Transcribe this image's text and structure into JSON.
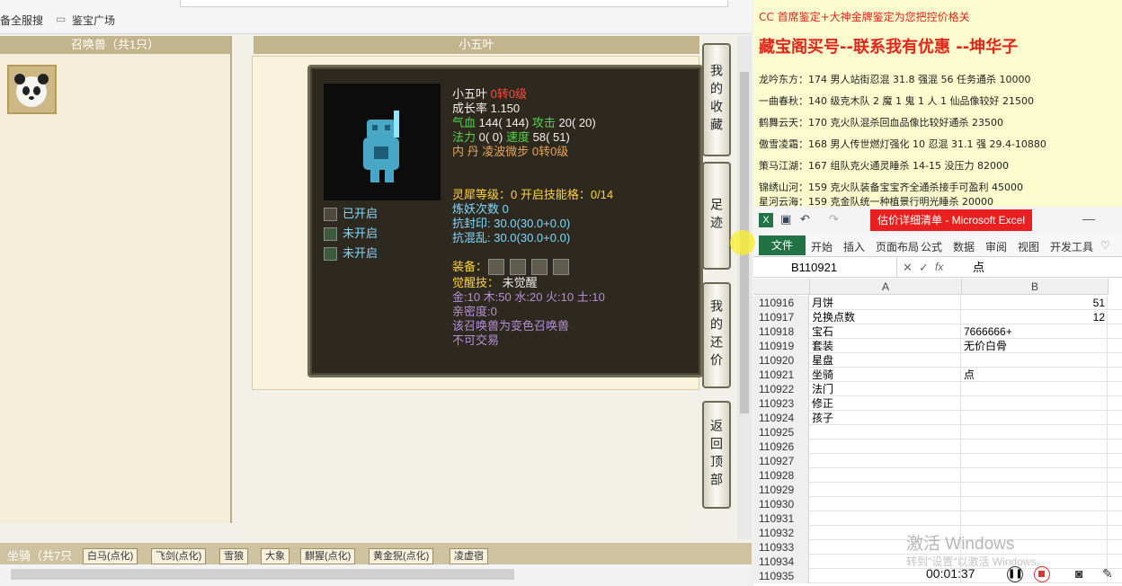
{
  "browser": {
    "bookmarks": [
      "备全服搜",
      "鉴宝广场"
    ]
  },
  "left_panel": {
    "title": "召唤兽（共1只）"
  },
  "center": {
    "title": "小五叶"
  },
  "pet": {
    "name": "小五叶",
    "name_suffix": "0转0级",
    "growth": "成长率 1.150",
    "hp_label": "气血 ",
    "hp_value": "144( 144)",
    "atk_label": "攻击 ",
    "atk_value": "20( 20)",
    "mp_label": "法力 ",
    "mp_value": "0( 0)",
    "spd_label": "速度 ",
    "spd_value": "58( 51)",
    "core_label": "内  丹 ",
    "core_value": "凌波微步 0转0级",
    "spirit": "灵犀等级：0 开启技能格：0/14",
    "refine": "炼妖次数 0",
    "resist1": "抗封印: 30.0(30.0+0.0)",
    "resist2": "抗混乱: 30.0(30.0+0.0)",
    "equip_label": "装备：",
    "awaken_label": "觉醒技：",
    "awaken_value": "未觉醒",
    "elements": "金:10 木:50 水:20 火:10 土:10",
    "intimacy": "亲密度:0",
    "note1": "该召唤兽为变色召唤兽",
    "note2": "不可交易",
    "skill_slots": [
      "已开启",
      "未开启",
      "未开启"
    ]
  },
  "side_buttons": [
    "我的收藏",
    "足迹",
    "我的还价",
    "返回顶部"
  ],
  "mount_bar": {
    "label": "坐骑（共7只",
    "tabs": [
      "白马(点化)",
      "飞剑(点化)",
      "雪狼",
      "大象",
      "麒猩(点化)",
      "黄金猊(点化)",
      "凌虚宿"
    ]
  },
  "overlay": {
    "line1": "CC 首席鉴定+大神金牌鉴定为您把控价格关",
    "line2": "藏宝阁买号--联系我有优惠 --坤华子",
    "entries": [
      "龙吟东方：174 男人站街忍混 31.8 强混 56 任务通杀 10000",
      "一曲春秋：140 级克木队 2 魔 1 鬼 1 人 1 仙品像较好 21500",
      "鹤舞云天：170 克火队混杀回血品像比较好通杀 23500",
      "傲雪凌霜：168 男人传世燃灯强化 10 忍混 31.1 强 29.4-10880",
      "策马江湖：167 组队克火通灵睡杀 14-15 没压力 82000",
      "锦绣山河：159 克火队装备宝宝齐全通杀接手可盈利 45000",
      "星河云海：159 克金队统一种植景行明光睡杀 20000"
    ]
  },
  "excel": {
    "title": "估价详细清单 - Microsoft Excel",
    "file_tab": "文件",
    "ribbon_tabs": [
      "开始",
      "插入",
      "页面布局",
      "公式",
      "数据",
      "审阅",
      "视图",
      "开发工具"
    ],
    "name_box": "B110921",
    "formula": "点",
    "col_a": "A",
    "col_b": "B",
    "rows": [
      {
        "n": "110916",
        "a": "月饼",
        "b": "51"
      },
      {
        "n": "110917",
        "a": "兑换点数",
        "b": "12"
      },
      {
        "n": "110918",
        "a": "宝石",
        "b": "7666666+"
      },
      {
        "n": "110919",
        "a": "套装",
        "b": "无价白骨"
      },
      {
        "n": "110920",
        "a": "星盘",
        "b": ""
      },
      {
        "n": "110921",
        "a": "坐骑",
        "b": "点"
      },
      {
        "n": "110922",
        "a": "法门",
        "b": ""
      },
      {
        "n": "110923",
        "a": "修正",
        "b": ""
      },
      {
        "n": "110924",
        "a": "孩子",
        "b": ""
      },
      {
        "n": "110925",
        "a": "",
        "b": ""
      },
      {
        "n": "110926",
        "a": "",
        "b": ""
      },
      {
        "n": "110927",
        "a": "",
        "b": ""
      },
      {
        "n": "110928",
        "a": "",
        "b": ""
      },
      {
        "n": "110929",
        "a": "",
        "b": ""
      },
      {
        "n": "110930",
        "a": "",
        "b": ""
      },
      {
        "n": "110931",
        "a": "",
        "b": ""
      },
      {
        "n": "110932",
        "a": "",
        "b": ""
      },
      {
        "n": "110933",
        "a": "",
        "b": ""
      },
      {
        "n": "110934",
        "a": "",
        "b": ""
      },
      {
        "n": "110935",
        "a": "",
        "b": ""
      }
    ]
  },
  "windows_watermark": {
    "line1": "激活 Windows",
    "line2": "转到\"设置\"以激活 Windows。"
  },
  "player": {
    "time": "00:01:37"
  },
  "colors": {
    "excel_green": "#217346",
    "title_red": "#ea1f1f",
    "panel_tan": "#c2b48c"
  }
}
